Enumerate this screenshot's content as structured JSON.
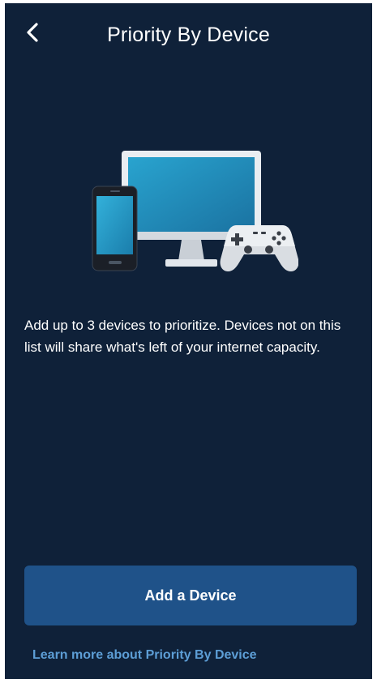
{
  "header": {
    "title": "Priority By Device",
    "back_icon": "chevron-left-icon"
  },
  "illustration": {
    "icons": [
      "smartphone-icon",
      "monitor-icon",
      "game-controller-icon"
    ]
  },
  "main": {
    "description": "Add up to 3 devices to prioritize. Devices not on this list will share what's left of your internet capacity."
  },
  "actions": {
    "add_device_label": "Add a Device",
    "learn_more_label": "Learn more about Priority By Device"
  },
  "colors": {
    "background": "#0f2139",
    "button": "#1f5289",
    "link": "#5d9ed6",
    "text": "#ffffff"
  }
}
